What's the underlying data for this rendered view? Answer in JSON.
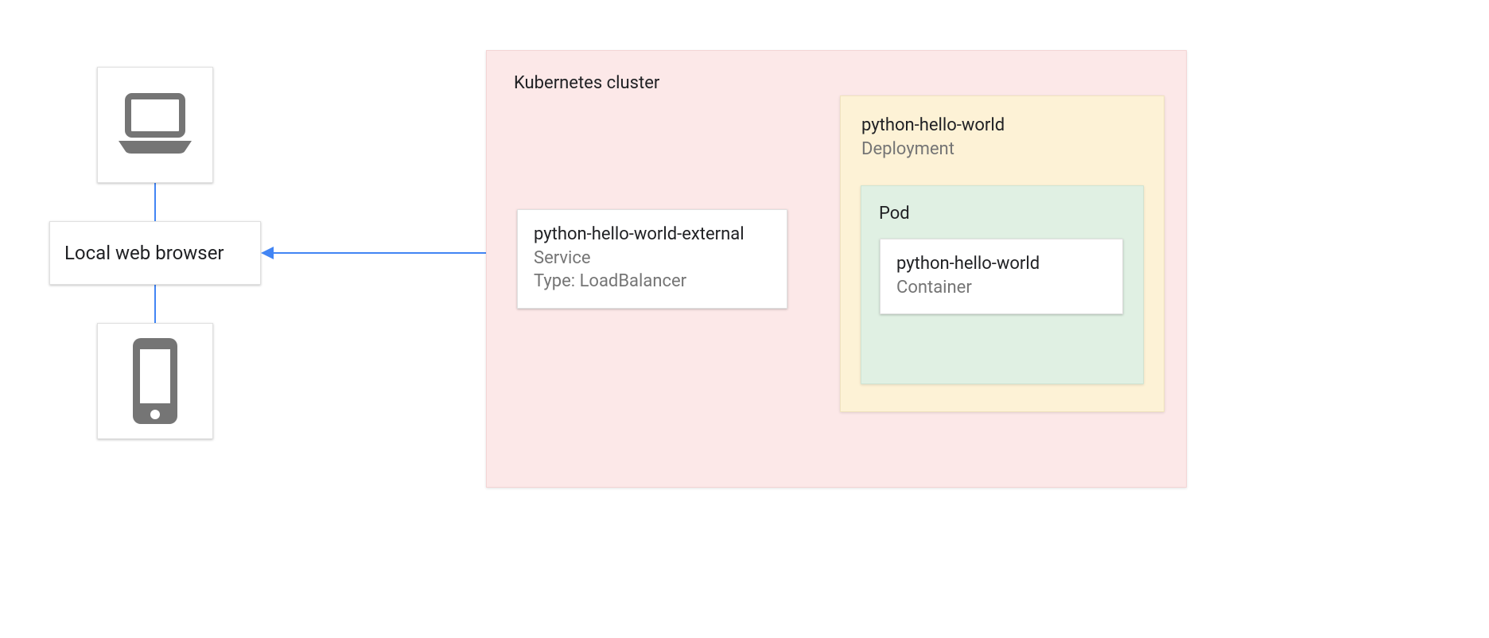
{
  "client": {
    "browser_label": "Local web browser",
    "laptop_icon": "laptop-icon",
    "phone_icon": "smartphone-icon"
  },
  "cluster": {
    "title": "Kubernetes cluster",
    "service": {
      "name": "python-hello-world-external",
      "kind": "Service",
      "type_line": "Type: LoadBalancer"
    },
    "deployment": {
      "name": "python-hello-world",
      "kind": "Deployment",
      "pod": {
        "title": "Pod",
        "container": {
          "name": "python-hello-world",
          "kind": "Container"
        }
      }
    }
  },
  "connections": [
    {
      "from": "laptop",
      "to": "browser",
      "bidirectional": false
    },
    {
      "from": "phone",
      "to": "browser",
      "bidirectional": false
    },
    {
      "from": "browser",
      "to": "service",
      "bidirectional": true
    },
    {
      "from": "service",
      "to": "pod",
      "bidirectional": true
    }
  ],
  "colors": {
    "cluster_bg": "#fce8e8",
    "deployment_bg": "#fdf2d6",
    "pod_bg": "#e0f0e3",
    "arrow": "#4285f4",
    "icon_gray": "#757575",
    "text_muted": "#757575"
  }
}
